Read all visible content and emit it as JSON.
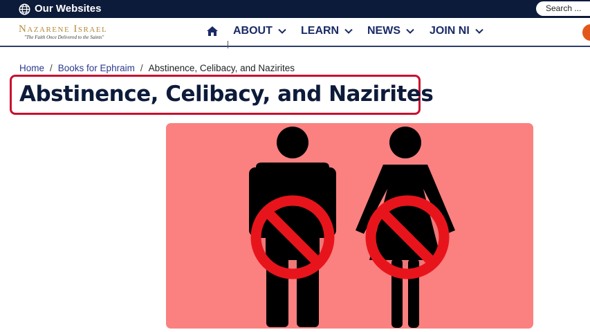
{
  "topbar": {
    "our_websites_label": "Our Websites",
    "search_placeholder": "Search ...",
    "globe_icon": "globe-icon",
    "background_color": "#0d1b3a"
  },
  "header": {
    "logo_name": "Nazarene Israel",
    "logo_tagline": "\"The Faith Once Delivered to the Saints\"",
    "home_icon": "home-icon",
    "nav_items": [
      {
        "label": "ABOUT"
      },
      {
        "label": "LEARN"
      },
      {
        "label": "NEWS"
      },
      {
        "label": "JOIN NI"
      }
    ],
    "accent_color": "#e4571c",
    "nav_color": "#1a2a66"
  },
  "breadcrumb": {
    "items": [
      {
        "label": "Home"
      },
      {
        "label": "Books for Ephraim"
      },
      {
        "label": "Abstinence, Celibacy, and Nazirites"
      }
    ],
    "separator": "/"
  },
  "page": {
    "title": "Abstinence, Celibacy, and Nazirites",
    "highlight_color": "#c8102e"
  },
  "hero_image": {
    "icons": [
      "man-figure-icon",
      "woman-figure-icon",
      "prohibited-icon"
    ],
    "background_color": "#fb8080"
  }
}
